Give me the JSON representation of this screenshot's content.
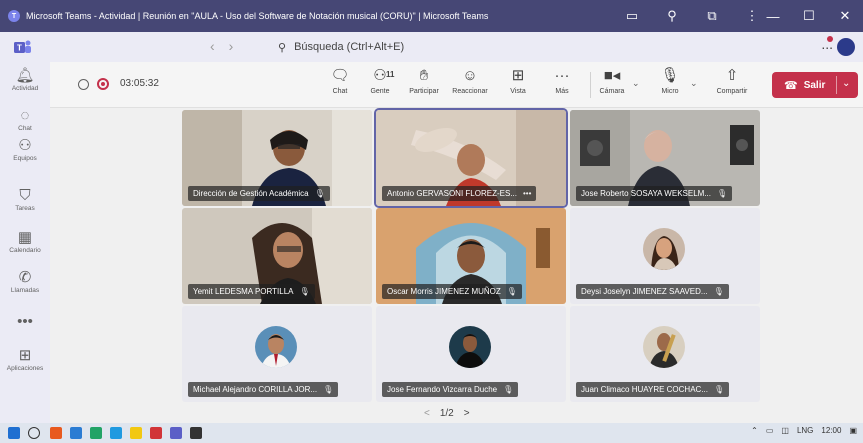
{
  "window": {
    "title": "Microsoft Teams - Actividad | Reunión en \"AULA - Uso del Software de Notación musical (CORU)\" | Microsoft Teams",
    "controls": [
      "minimize",
      "maximize",
      "close"
    ]
  },
  "search": {
    "placeholder": "Búsqueda (Ctrl+Alt+E)",
    "more_label": "..."
  },
  "rail": {
    "items": [
      {
        "label": "Actividad",
        "icon": "bell-icon"
      },
      {
        "label": "Chat",
        "icon": "chat-icon"
      },
      {
        "label": "Equipos",
        "icon": "teams-icon"
      },
      {
        "label": "Tareas",
        "icon": "tasks-icon"
      },
      {
        "label": "Calendario",
        "icon": "calendar-icon"
      },
      {
        "label": "Llamadas",
        "icon": "phone-icon"
      },
      {
        "label": "•••",
        "icon": "more-icon"
      },
      {
        "label": "Aplicaciones",
        "icon": "apps-icon"
      }
    ]
  },
  "meeting": {
    "timer": "03:05:32",
    "people_count": "11",
    "buttons": {
      "chat": "Chat",
      "people": "Gente",
      "raise": "Participar",
      "react": "Reaccionar",
      "view": "Vista",
      "more": "Más",
      "camera": "Cámara",
      "mic": "Micro",
      "share": "Compartir"
    },
    "leave_label": "Salir"
  },
  "participants": [
    {
      "name": "Dirección de Gestión Académica"
    },
    {
      "name": "Antonio GERVASONI FLOREZ-ES...",
      "more": "•••"
    },
    {
      "name": "Jose Roberto SOSAYA WEKSELM..."
    },
    {
      "name": "Yemit LEDESMA PORTILLA"
    },
    {
      "name": "Oscar Morris JIMENEZ MUÑOZ"
    },
    {
      "name": "Deysi Joselyn JIMENEZ SAAVED..."
    },
    {
      "name": "Michael Alejandro CORILLA JOR..."
    },
    {
      "name": "Jose Fernando Vizcarra Duche"
    },
    {
      "name": "Juan Climaco HUAYRE COCHAC..."
    }
  ],
  "pager": {
    "label": "1/2",
    "prev": "<",
    "next": ">"
  },
  "taskbar": {
    "lang": "LNG",
    "time": "12:00"
  },
  "colors": {
    "titlebar": "#464775",
    "accent": "#6264a7",
    "leave": "#c4314b",
    "stage": "#f0f0f0"
  }
}
